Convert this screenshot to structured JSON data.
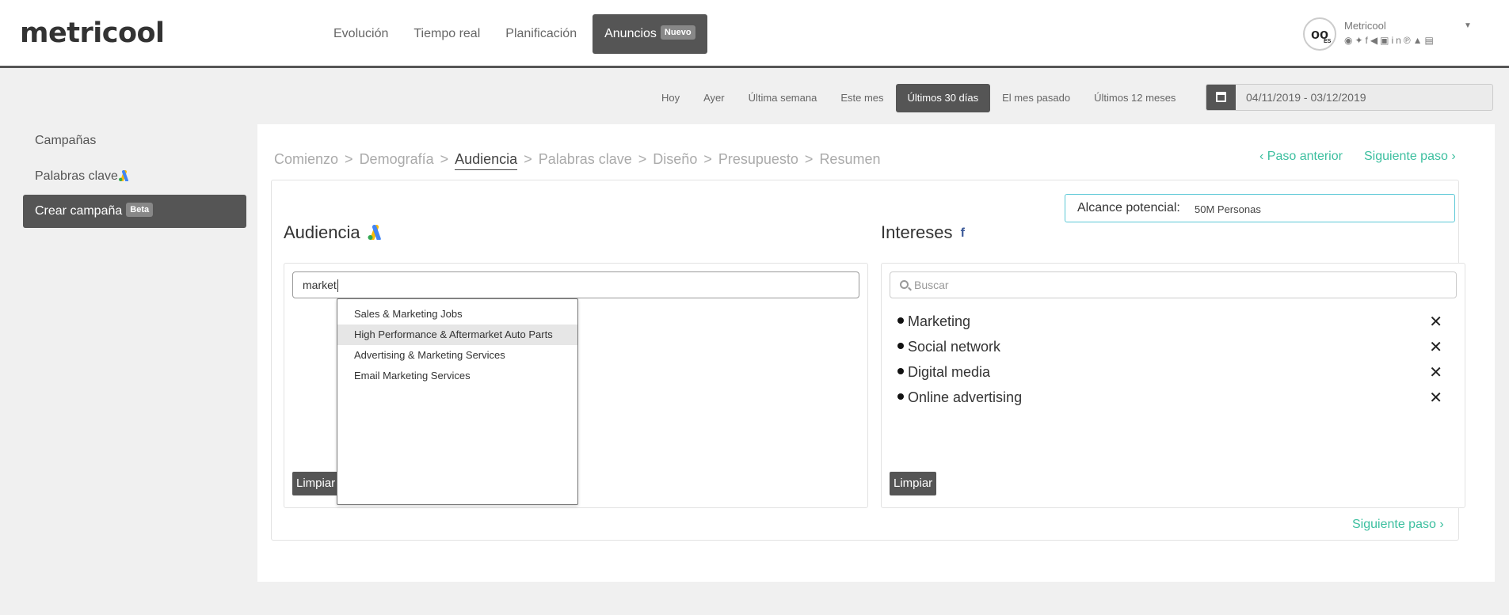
{
  "brand": {
    "logo": "metricool"
  },
  "nav": {
    "items": [
      "Evolución",
      "Tiempo real",
      "Planificación"
    ],
    "active": {
      "label": "Anuncios",
      "badge": "Nuevo"
    }
  },
  "profile": {
    "name": "Metricool",
    "avatar_text": "oo",
    "avatar_sub": "ES",
    "icons": "rss twitter facebook megaphone instagram linkedin pinterest adwords store"
  },
  "date_filter": {
    "options": [
      "Hoy",
      "Ayer",
      "Última semana",
      "Este mes",
      "Últimos 30 días",
      "El mes pasado",
      "Últimos 12 meses"
    ],
    "active_index": 4,
    "range": "04/11/2019 - 03/12/2019"
  },
  "sidebar": {
    "items": [
      {
        "label": "Campañas"
      },
      {
        "label": "Palabras clave"
      },
      {
        "label": "Crear campaña",
        "badge": "Beta"
      }
    ]
  },
  "wizard": {
    "steps": [
      "Comienzo",
      "Demografía",
      "Audiencia",
      "Palabras clave",
      "Diseño",
      "Presupuesto",
      "Resumen"
    ],
    "active_step": 2,
    "prev_label": "Paso anterior",
    "next_label": "Siguiente paso"
  },
  "alcance": {
    "label": "Alcance potencial:",
    "value": "50M Personas"
  },
  "audiencia": {
    "title": "Audiencia",
    "input_value": "market",
    "clear_label": "Limpiar",
    "suggestions": [
      "Sales & Marketing Jobs",
      "High Performance & Aftermarket Auto Parts",
      "Advertising & Marketing Services",
      "Email Marketing Services"
    ],
    "highlighted_index": 1
  },
  "intereses": {
    "title": "Intereses",
    "search_placeholder": "Buscar",
    "items": [
      "Marketing",
      "Social network",
      "Digital media",
      "Online advertising"
    ],
    "remove_glyph": "✕",
    "clear_label": "Limpiar"
  },
  "colors": {
    "accent": "#3cbf9f",
    "dark": "#555555",
    "alcance_border": "#5bc8d6",
    "facebook": "#3b5998"
  }
}
